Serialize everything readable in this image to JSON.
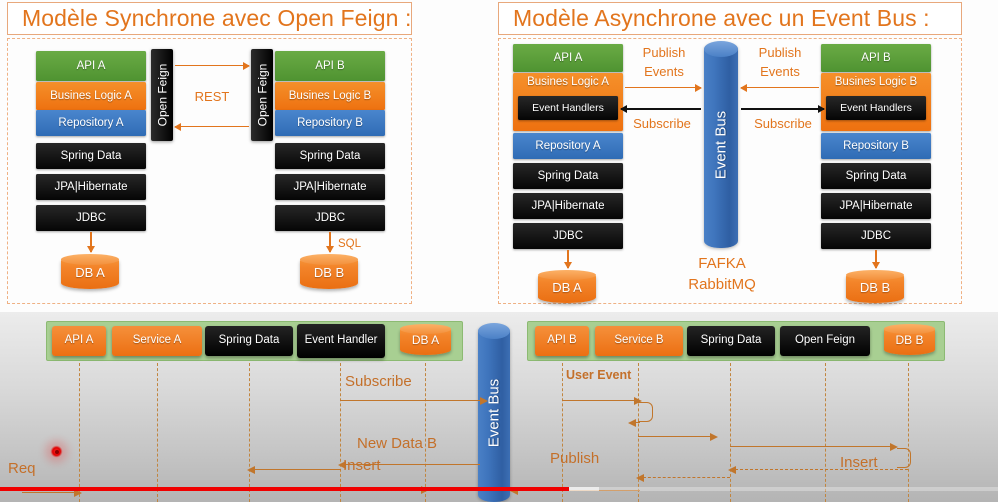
{
  "sync_panel": {
    "title": "Modèle Synchrone avec Open Feign :",
    "left_stack": [
      "API A",
      "Busines Logic A",
      "Repository A",
      "Spring Data",
      "JPA|Hibernate",
      "JDBC"
    ],
    "right_stack": [
      "API B",
      "Busines Logic B",
      "Repository B",
      "Spring Data",
      "JPA|Hibernate",
      "JDBC"
    ],
    "feign_left": "Open Feign",
    "feign_right": "Open Feign",
    "middle_label": "REST",
    "db_left": "DB A",
    "db_right": "DB B",
    "sql_label": "SQL"
  },
  "async_panel": {
    "title": "Modèle Asynchrone avec un Event Bus :",
    "left_stack": [
      "API A",
      "Busines Logic A",
      "Repository A",
      "Spring Data",
      "JPA|Hibernate",
      "JDBC"
    ],
    "right_stack": [
      "API B",
      "Busines Logic B",
      "Repository B",
      "Spring Data",
      "JPA|Hibernate",
      "JDBC"
    ],
    "event_handler_left": "Event Handlers",
    "event_handler_right": "Event Handlers",
    "bus_label": "Event Bus",
    "bus_sub_line1": "FAFKA",
    "bus_sub_line2": "RabbitMQ",
    "publish_left_line1": "Publish",
    "publish_left_line2": "Events",
    "publish_right_line1": "Publish",
    "publish_right_line2": "Events",
    "subscribe_left": "Subscribe",
    "subscribe_right": "Subscribe",
    "db_left": "DB A",
    "db_right": "DB B"
  },
  "sequence": {
    "left_nodes": [
      "API A",
      "Service A",
      "Spring Data",
      "Event Handler",
      "DB A"
    ],
    "right_nodes": [
      "API B",
      "Service B",
      "Spring Data",
      "Open Feign",
      "DB B"
    ],
    "bus_label": "Event Bus",
    "labels": {
      "req": "Req",
      "subscribe": "Subscribe",
      "new_data_b": "New Data B",
      "insert_left": "Insert",
      "user_event": "User Event",
      "publish": "Publish",
      "insert_right": "Insert"
    }
  },
  "player": {
    "played_percent": 57,
    "buffered_percent": 60
  },
  "colors": {
    "accent_orange": "#e2751d",
    "api_green": "#5a9e3b",
    "logic_orange": "#f07d18",
    "repo_blue": "#3b78c4",
    "tech_black": "#111111",
    "band_green": "#a8cf92",
    "bus_blue": "#3f75bd",
    "progress_red": "#f00000"
  }
}
